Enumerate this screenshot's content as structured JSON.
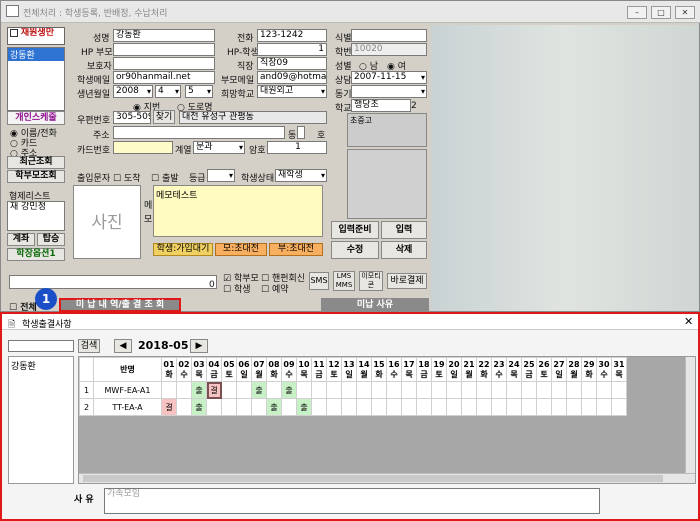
{
  "window": {
    "title": "전체처리 : 학생등록, 반배정, 수납처리"
  },
  "left": {
    "checkbox_label": "재원생만",
    "selected_student": "강동환",
    "search_btn": "개인스케줄",
    "radio_name": "이름/전화",
    "radio_card": "카드",
    "radio_addr": "주소",
    "recent_btn": "최근조회",
    "parent_btn": "학부모조회",
    "sibling_label": "형제리스트",
    "sibling_value": "재 강민정",
    "btn_payment": "계좌",
    "btn_ride": "탑승",
    "btn_extra": "학장옵션1"
  },
  "form": {
    "name_lbl": "성명",
    "name": "강동환",
    "phone_lbl": "전화",
    "phone": "123-1242",
    "hp_parent_lbl": "HP 부모",
    "hp_student_lbl": "HP-학생",
    "hp_student": "1",
    "guardian_lbl": "보호자",
    "job_lbl": "직장",
    "job": "직장09",
    "email_lbl": "학생메일",
    "email": "or90hanmail.net",
    "parent_email_lbl": "부모메일",
    "parent_email": "and09@hotmail.",
    "birth_lbl": "생년월일",
    "birth_y": "2008",
    "birth_m": "4",
    "birth_d": "5",
    "hope_lbl": "희망학교",
    "hope": "대원외고",
    "addr_type1": "지번",
    "addr_type2": "도로명",
    "zip_lbl": "우편번호",
    "zip": "305-509",
    "zip_btn": "찾기",
    "addr_city": "대전 유성구 관평동",
    "addr_lbl": "주소",
    "addr_dong": "동",
    "addr_ho": "호",
    "card_lbl": "카드번호",
    "class_lbl": "계열",
    "class": "문과",
    "pw_lbl": "암호",
    "pw": "1",
    "attend_lbl": "출입문자",
    "opt_arrive": "도착",
    "opt_depart": "출발",
    "grade_lbl": "등급",
    "status_lbl": "학생상태",
    "status": "재학생",
    "photo": "사진",
    "memo_side": "메 모",
    "memo": "메모테스트",
    "tag1": "학생:가입대기",
    "tag2": "모:초대전",
    "tag3": "부:초대전",
    "id_lbl": "식별",
    "sno_lbl": "학번",
    "sno": "10020",
    "gender_lbl": "성별",
    "gender_m": "남",
    "gender_f": "여",
    "consult_lbl": "상담",
    "consult": "2007-11-15",
    "motive_lbl": "동기",
    "school_lbl": "학교",
    "school": "행당초",
    "school_grade": "2",
    "grade_list": "초중고",
    "btn_prepare": "입력준비",
    "btn_input": "입력",
    "btn_edit": "수정",
    "btn_delete": "삭제"
  },
  "bottom": {
    "zero": "0",
    "chk_parent": "학부모",
    "chk_student": "학생",
    "chk_recent": "핸펀회신",
    "chk_reserve": "예약",
    "sms": "SMS",
    "lms": "LMS MMS",
    "memo": "이모티콘",
    "pay": "바로결제",
    "all_lbl": "전체",
    "unpaid_tab": "미 납 내 역/출 결 조 회",
    "unpaid_reason": "미납 사유",
    "badge": "1"
  },
  "popup": {
    "title": "학생출결사항",
    "search_btn": "검색",
    "month": "2018-05",
    "student": "강동환",
    "col_class": "반명",
    "days": [
      "01",
      "02",
      "03",
      "04",
      "05",
      "06",
      "07",
      "08",
      "09",
      "10",
      "11",
      "12",
      "13",
      "14",
      "15",
      "16",
      "17",
      "18",
      "19",
      "20",
      "21",
      "22",
      "23",
      "24",
      "25",
      "26",
      "27",
      "28",
      "29",
      "30",
      "31"
    ],
    "weekdays": [
      "화",
      "수",
      "목",
      "금",
      "토",
      "일",
      "월",
      "화",
      "수",
      "목",
      "금",
      "토",
      "일",
      "월",
      "화",
      "수",
      "목",
      "금",
      "토",
      "일",
      "월",
      "화",
      "수",
      "목",
      "금",
      "토",
      "일",
      "월",
      "화",
      "수",
      "목"
    ],
    "rows": [
      {
        "no": "1",
        "cls": "MWF-EA-A1",
        "marks": {
          "2": "출",
          "3": "결",
          "6": "출",
          "8": "출"
        }
      },
      {
        "no": "2",
        "cls": "TT-EA-A",
        "marks": {
          "0": "결",
          "2": "출",
          "7": "출",
          "9": "출"
        }
      }
    ],
    "reason_lbl": "사 유",
    "reason_ph": "가족모임"
  }
}
